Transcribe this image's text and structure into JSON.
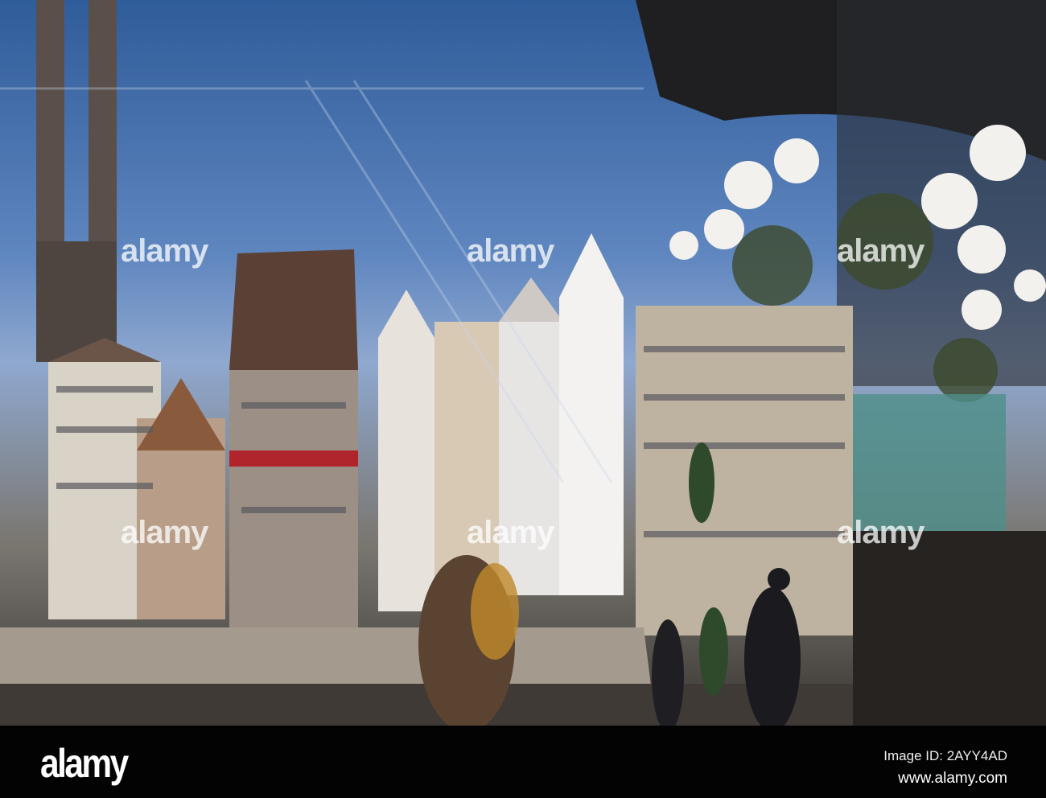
{
  "watermark": "alamy",
  "footer": {
    "logo": "alamy",
    "image_id": "Image ID: 2AYY4AD",
    "website": "www.alamy.com"
  }
}
